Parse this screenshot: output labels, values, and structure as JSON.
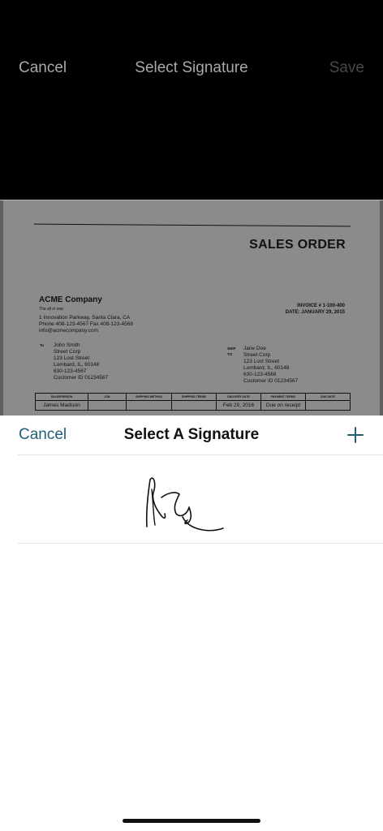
{
  "top_bar": {
    "cancel_label": "Cancel",
    "title": "Select Signature",
    "save_label": "Save"
  },
  "document": {
    "title": "SALES ORDER",
    "company": {
      "name": "ACME Company",
      "tagline": "The all in one",
      "address": "1 Innovation Parkway, Santa Clara, CA",
      "phone_fax": "Phone 408-123-4567 Fax 408-123-4568",
      "email": "info@acmecompany.com"
    },
    "invoice_number": "INVOICE # 1-100-400",
    "date": "DATE: JANUARY 29, 2015",
    "to_label": "To",
    "to_lines": [
      "John Smith",
      "Street Corp",
      "123 Lost Street",
      "Lombard, IL, 60148",
      "630-123-4567",
      "Customer ID 01234567"
    ],
    "ship_label": "SHIP",
    "ship_to_label": "TO",
    "ship_lines": [
      "Jane Doe",
      "Street Corp",
      "123 Lost Street",
      "Lombard, IL, 60148",
      "630-123-4568",
      "Customer ID 01234567"
    ],
    "table_headers": [
      "SALESPERSON",
      "JOB",
      "SHIPPING METHOD",
      "SHIPPING TERMS",
      "DELIVERY DATE",
      "PAYMENT TERMS",
      "DUE DATE"
    ],
    "table_row": [
      "James Madison",
      "",
      "",
      "",
      "Feb 29, 2016",
      "Due on receipt",
      ""
    ]
  },
  "sheet": {
    "cancel_label": "Cancel",
    "title": "Select A Signature",
    "add_icon": "plus-icon",
    "signature_icon": "handwritten-signature"
  },
  "colors": {
    "top_bar_bg": "#000000",
    "sheet_accent": "#1f5f7a",
    "disabled_text": "#48484b",
    "divider": "#e3e3e6"
  }
}
